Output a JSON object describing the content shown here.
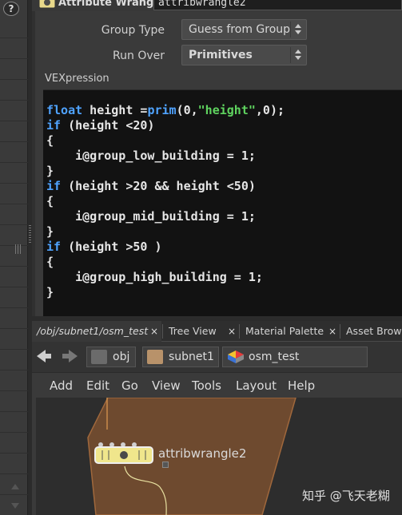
{
  "header": {
    "node_type": "Attribute Wrangle",
    "node_name": "attribwrangle2"
  },
  "params": {
    "group_type_label": "Group Type",
    "group_type_value": "Guess from Group",
    "run_over_label": "Run Over",
    "run_over_value": "Primitives",
    "vex_label": "VEXpression"
  },
  "code_lines": [
    "float height =prim(0,\"height\",0);",
    "if (height <20)",
    "{",
    "    i@group_low_building = 1;",
    "}",
    "if (height >20 && height <50)",
    "{",
    "    i@group_mid_building = 1;",
    "}",
    "if (height >50 )",
    "{",
    "    i@group_high_building = 1;",
    "}"
  ],
  "tabs": [
    {
      "label": "/obj/subnet1/osm_test",
      "active": true
    },
    {
      "label": "Tree View",
      "active": false
    },
    {
      "label": "Material Palette",
      "active": false
    },
    {
      "label": "Asset Browse",
      "active": false
    }
  ],
  "tab_close": "×",
  "path": [
    "obj",
    "subnet1",
    "osm_test"
  ],
  "menu": [
    "Add",
    "Edit",
    "Go",
    "View",
    "Tools",
    "Layout",
    "Help"
  ],
  "network": {
    "node_name": "attribwrangle2",
    "watermark": "知乎 @飞天老糊"
  },
  "help_icon": "?",
  "colors": {
    "keyword": "#4fa3ff",
    "string": "#5fd35f",
    "network_box": "#6e4a2f",
    "node_fill": "#f0e68c"
  }
}
